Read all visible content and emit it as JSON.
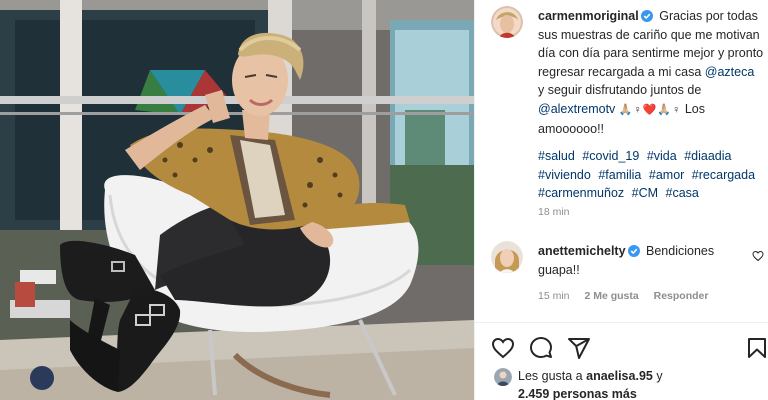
{
  "post": {
    "author": "carmenmoriginal",
    "caption_part1": "Gracias por todas sus muestras de cariño que me motivan día con día para sentirme mejor y pronto regresar recargada a mi casa",
    "mention1": "@azteca",
    "caption_part2": "y seguir disfrutando juntos de",
    "mention2": "@alextremotv",
    "emojis": "🙏🏼♀❤️🙏🏼♀",
    "caption_part3": "Los amoooooo!!",
    "hashtags": [
      "#salud",
      "#covid_19",
      "#vida",
      "#diaadia",
      "#viviendo",
      "#familia",
      "#amor",
      "#recargada",
      "#carmenmuñoz",
      "#CM",
      "#casa"
    ],
    "time": "18 min"
  },
  "comment": {
    "author": "anettemichelty",
    "text": "Bendiciones guapa!!",
    "time": "15 min",
    "likes": "2 Me gusta",
    "reply": "Responder"
  },
  "likes": {
    "prefix": "Les gusta a",
    "user": "anaelisa.95",
    "suffix": "y",
    "count": "2.459 personas más"
  },
  "icons": {
    "verified": "verified-badge-icon",
    "like": "heart-icon",
    "comment": "comment-bubble-icon",
    "share": "paper-plane-icon",
    "save": "bookmark-icon"
  },
  "colors": {
    "verified": "#3897f0",
    "link": "#00376b",
    "muted": "#8e8e8e"
  }
}
